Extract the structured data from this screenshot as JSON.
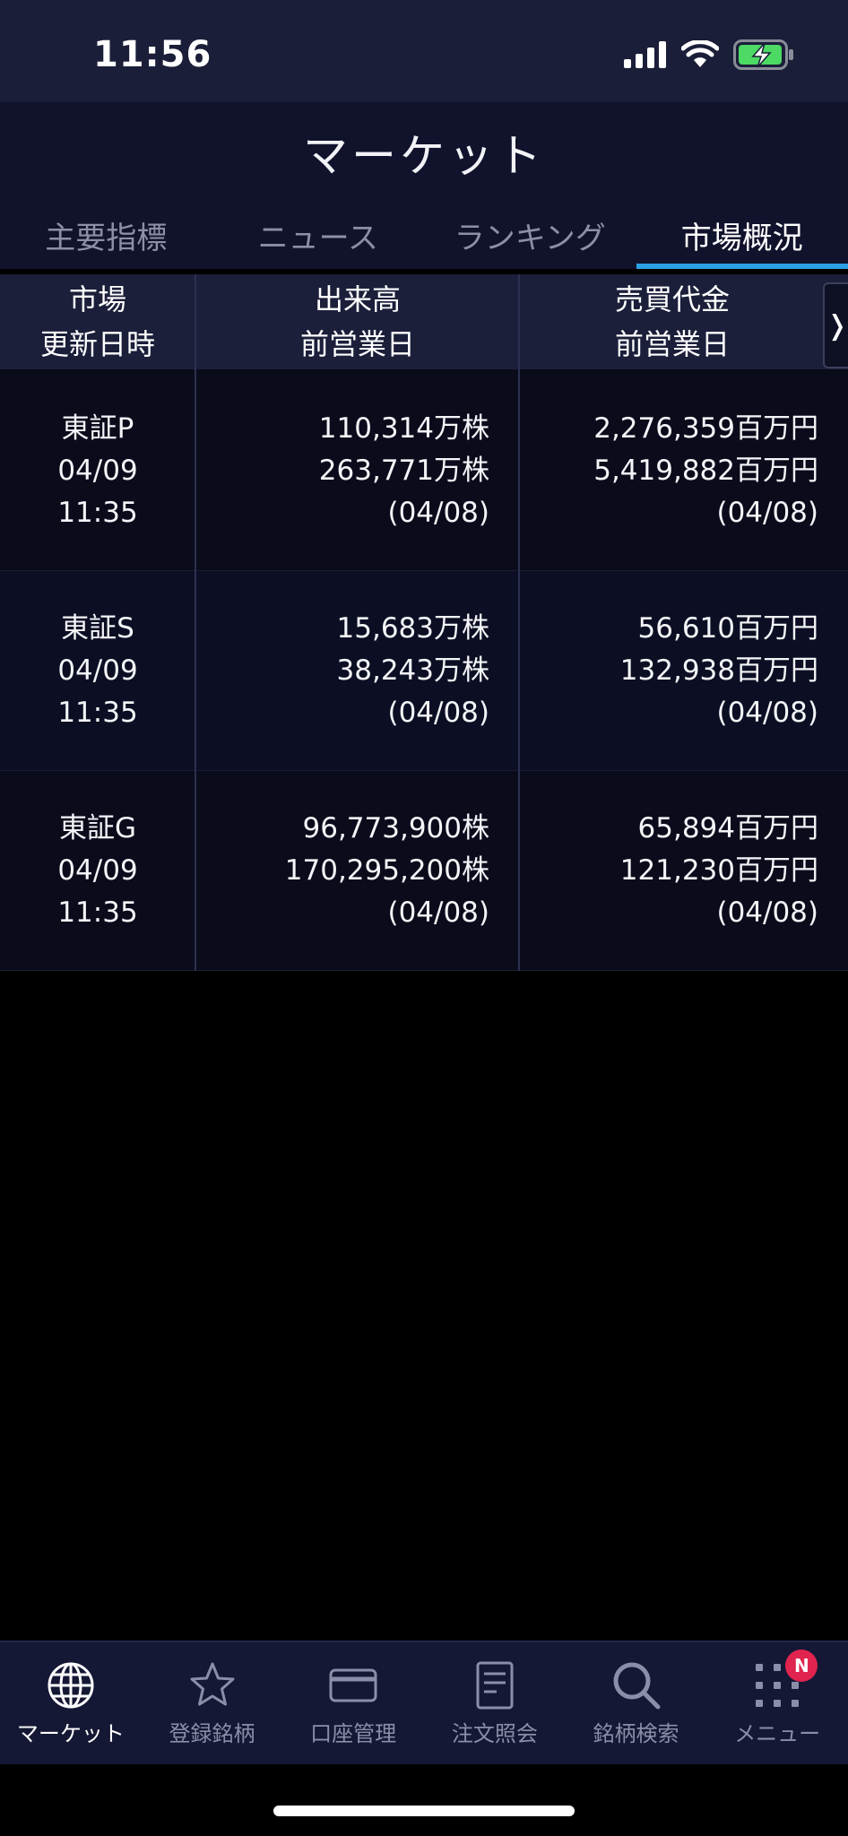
{
  "status": {
    "time": "11:56"
  },
  "header": {
    "title": "マーケット",
    "tabs": [
      {
        "label": "主要指標",
        "active": false
      },
      {
        "label": "ニュース",
        "active": false
      },
      {
        "label": "ランキング",
        "active": false
      },
      {
        "label": "市場概況",
        "active": true
      }
    ]
  },
  "table": {
    "headers": [
      {
        "line1": "市場",
        "line2": "更新日時"
      },
      {
        "line1": "出来高",
        "line2": "前営業日"
      },
      {
        "line1": "売買代金",
        "line2": "前営業日"
      }
    ],
    "scroll_icon": "chevron-right-icon",
    "rows": [
      {
        "market": "東証P",
        "date": "04/09",
        "time": "11:35",
        "volume": "110,314万株",
        "volume_prev": "263,771万株",
        "volume_prev_date": "(04/08)",
        "value": "2,276,359百万円",
        "value_prev": "5,419,882百万円",
        "value_prev_date": "(04/08)"
      },
      {
        "market": "東証S",
        "date": "04/09",
        "time": "11:35",
        "volume": "15,683万株",
        "volume_prev": "38,243万株",
        "volume_prev_date": "(04/08)",
        "value": "56,610百万円",
        "value_prev": "132,938百万円",
        "value_prev_date": "(04/08)"
      },
      {
        "market": "東証G",
        "date": "04/09",
        "time": "11:35",
        "volume": "96,773,900株",
        "volume_prev": "170,295,200株",
        "volume_prev_date": "(04/08)",
        "value": "65,894百万円",
        "value_prev": "121,230百万円",
        "value_prev_date": "(04/08)"
      }
    ]
  },
  "tabbar": {
    "items": [
      {
        "label": "マーケット",
        "icon": "globe-icon",
        "active": true
      },
      {
        "label": "登録銘柄",
        "icon": "star-icon",
        "active": false
      },
      {
        "label": "口座管理",
        "icon": "card-icon",
        "active": false
      },
      {
        "label": "注文照会",
        "icon": "document-icon",
        "active": false
      },
      {
        "label": "銘柄検索",
        "icon": "search-icon",
        "active": false
      },
      {
        "label": "メニュー",
        "icon": "grid-menu-icon",
        "active": false,
        "badge": "N"
      }
    ]
  },
  "colors": {
    "accent": "#2aa0e6",
    "header_bg": "#11132d",
    "tabbar_bg": "#151834",
    "badge": "#e0244f",
    "battery_fill": "#4cd964"
  }
}
